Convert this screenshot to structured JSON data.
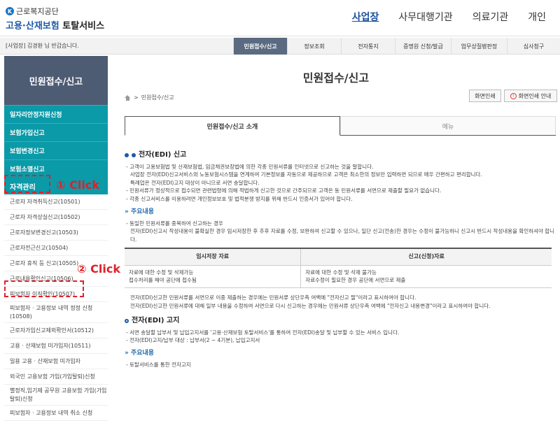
{
  "header": {
    "org_name": "근로복지공단",
    "service_line1": "고용·산재보험",
    "service_line2": "토탈서비스",
    "nav": [
      "사업장",
      "사무대행기관",
      "의료기관",
      "개인"
    ]
  },
  "subbar": {
    "welcome": "[사업장] 김경환 님 반갑습니다.",
    "menu": [
      "민원접수/신고",
      "정보조회",
      "전자통지",
      "증명원 신청/발급",
      "업무상질병판정",
      "심사청구"
    ]
  },
  "sidebar": {
    "title": "민원접수/신고",
    "teal_items": [
      "일자리안정지원신청",
      "보험가입신고",
      "보험변경신고",
      "보험소멸신고"
    ],
    "active_item": "자격관리",
    "items": [
      "근로자 자격취득신고(10501)",
      "근로자 자격상실신고(10502)",
      "근로자정보변경신고(10503)",
      "근로자전근신고(10504)",
      "근로자 휴직 등 신고(10505)",
      "근로내용확인신고(10506)",
      "피보험자 이직확인(10507)",
      "피보험자 · 고용정보 내역 정정 신청(10508)",
      "근로자가입신고제외확인서(10512)",
      "고용 · 산재보험 미가입자(10511)",
      "일용 고용 · 산재보험 미가입자",
      "외국인 고용보험 가입(가입탈퇴)신청",
      "별정직,임기제 공무원 고용보험 가입(가입탈퇴)신청",
      "피보험자 · 고용정보 내역 취소 신청"
    ]
  },
  "annotations": {
    "click1": "① Click",
    "click2": "② Click"
  },
  "main": {
    "title": "민원접수/신고",
    "breadcrumb": "민원접수/신고",
    "print_btn": "화면인쇄",
    "print_guide_btn": "화면인쇄 안내",
    "tabs": [
      "민원접수/신고 소개",
      "메뉴"
    ],
    "section1_title": "전자(EDI) 신고",
    "s1_lines": [
      "- 고객이 고용보험법 및 산재보험법, 임금채권보장법에 의한 각종 민원서류를 인터넷으로 신고하는 것을 말합니다.",
      "사업장 전자(EDI)신고서비스와 노동보험시스템을 연계하여 기본정보를 자동으로 제공하므로 고객은 최소한의 정보만 입력하면 되므로 매우 간편하고 편리합니다.",
      "특례업은 전자(EDI)고지 대상이 아니므로 서면 송달합니다.",
      "- 민원서류가 정상적으로 접수되면 관련법령에 의해 적법하게 신고한 것으로 간주되므로 고객은 동 민원서류를 서면으로 제출할 필요가 없습니다.",
      "- 각종 신고서비스를 이용하려면 개인정보보호 및 법적분쟁 방지를 위해 반드시 인증서가 있어야 합니다."
    ],
    "sub1_title": "주요내용",
    "sub1_lines": [
      "- 동일한 민원서류를 중복하여 신고하는 경우",
      "전자(EDI)신고시 작성내용이 불확실한 경우 임시저장한 후 추후 자료를 수정, 보완하여 신고할 수 있으나, 일단 신고(전송)한 경우는 수정이 불가능하니 신고시 반드시 작성내용을 확인하셔야 합니다."
    ],
    "table": {
      "headers": [
        "임시저장 자료",
        "신고(신청)자료"
      ],
      "rows": [
        [
          "자료에 대한 수정 및 삭제가능",
          "자료에 대한 수정 및 삭제 불가능"
        ],
        [
          "접수처리를 해야 공단에 접수됨",
          "자료수정이 필요한 경우 공단에 서면으로 제출"
        ]
      ]
    },
    "after_table": [
      "전자(EDI)신고한 민원서류를 서면으로 이중 제출하는 경우에는 민원서류 상단우측 여백에 \"전자신고 필\"이라고 표시하여야 합니다.",
      "전자(EDI)신고한 민원서류에 대해 일부 내용을 수정하여 서면으로 다시 신고하는 경우에는 민원서류 상단우측 여백에 \"전자신고 내용변경\"이라고 표시하여야 합니다."
    ],
    "section2_title": "전자(EDI) 고지",
    "s2_lines": [
      "- 서면 송달할 납부서 및 납입고지서를 '고용·산재보험 토탈서비스'를 통하여 전자(EDI)송달 및 납부할 수 있는 서비스 입니다.",
      "- 전자(EDI)고지/납부 대상 : 납부서(2 ~ 4기분), 납입고지서"
    ],
    "sub2_title": "주요내용",
    "sub2_lines": [
      "- 토탈서비스를 통한 전자고지"
    ]
  }
}
